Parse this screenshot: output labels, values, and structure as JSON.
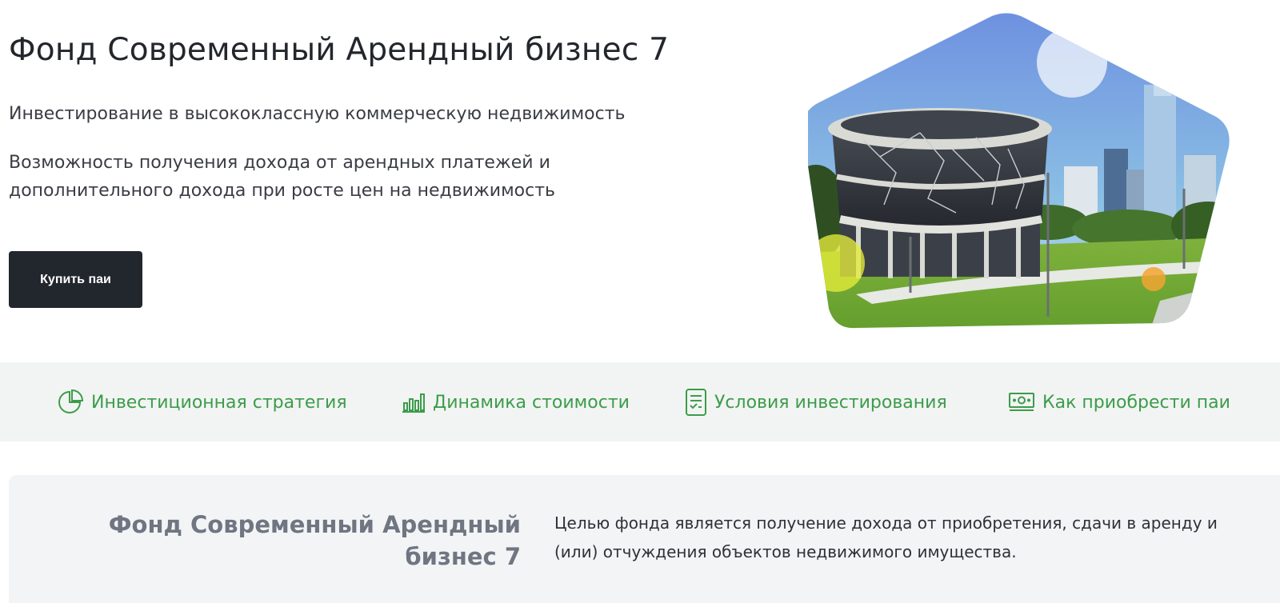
{
  "hero": {
    "title": "Фонд Современный Арендный бизнес 7",
    "subtitle": "Инвестирование в высококлассную коммерческую недвижимость",
    "description": "Возможность получения дохода от арендных платежей и дополнительного дохода при росте цен на недвижимость",
    "buy_button": "Купить паи",
    "image_icon": "building-photo"
  },
  "nav": {
    "items": [
      {
        "label": "Инвестиционная стратегия",
        "icon": "pie-chart-icon"
      },
      {
        "label": "Динамика стоимости",
        "icon": "bar-chart-icon"
      },
      {
        "label": "Условия инвестирования",
        "icon": "document-list-icon"
      },
      {
        "label": "Как приобрести паи",
        "icon": "money-icon"
      }
    ]
  },
  "about": {
    "title": "Фонд Современный Арендный бизнес 7",
    "text": "Целью фонда является получение дохода от приобретения, сдачи в аренду и (или) отчуждения объектов недвижимого имущества."
  },
  "colors": {
    "accent_green": "#3c9c4a",
    "button_dark": "#22262d",
    "nav_band_bg": "#f2f4f3",
    "card_bg": "#f3f4f6"
  }
}
